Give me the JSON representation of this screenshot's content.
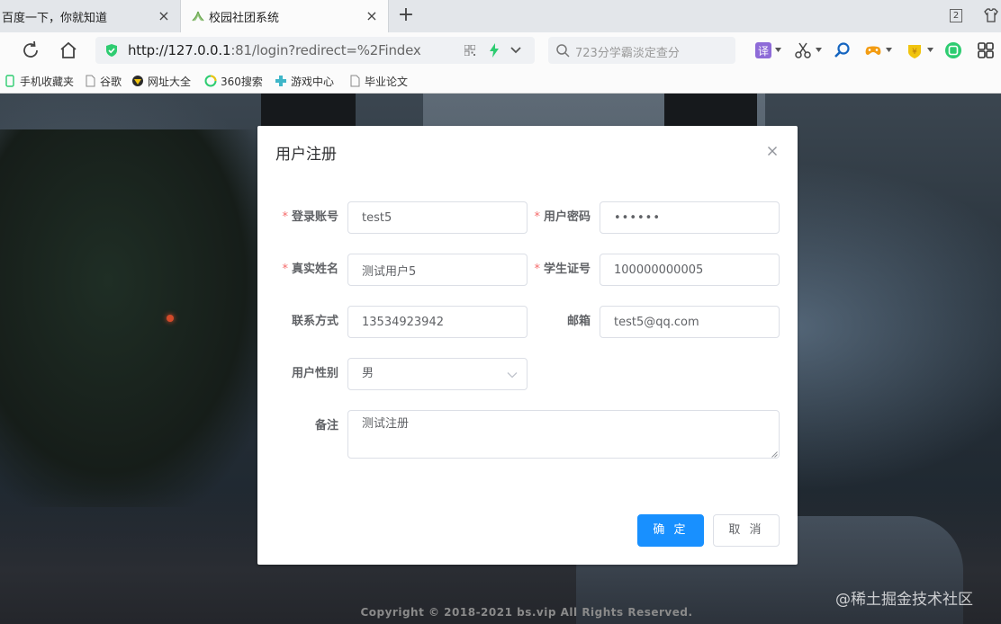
{
  "browser": {
    "tabs": [
      {
        "title": "百度一下，你就知道",
        "active": false
      },
      {
        "title": "校园社团系统",
        "active": true
      }
    ],
    "new_tab_symbol": "+",
    "tab_counter": "2",
    "url_host": "http://127.0.0.1",
    "url_rest": ":81/login?redirect=%2Findex",
    "search_placeholder": "723分学霸淡定查分",
    "bookmarks": [
      "手机收藏夹",
      "谷歌",
      "网址大全",
      "360搜索",
      "游戏中心",
      "毕业论文"
    ]
  },
  "dialog": {
    "title": "用户注册",
    "required_mark": "*",
    "fields": {
      "account": {
        "label": "登录账号",
        "value": "test5",
        "required": true
      },
      "password": {
        "label": "用户密码",
        "value": "••••••",
        "required": true
      },
      "real_name": {
        "label": "真实姓名",
        "value": "测试用户5",
        "required": true
      },
      "student_id": {
        "label": "学生证号",
        "value": "100000000005",
        "required": true
      },
      "phone": {
        "label": "联系方式",
        "value": "13534923942",
        "required": false
      },
      "email": {
        "label": "邮箱",
        "value": "test5@qq.com",
        "required": false
      },
      "gender": {
        "label": "用户性别",
        "value": "男",
        "required": false
      },
      "remark": {
        "label": "备注",
        "value": "测试注册",
        "required": false
      }
    },
    "confirm_label": "确 定",
    "cancel_label": "取 消"
  },
  "page": {
    "copyright": "Copyright © 2018-2021 bs.vip All Rights Reserved.",
    "watermark": "@稀土掘金技术社区"
  },
  "colors": {
    "primary": "#1890ff",
    "required": "#f56c6c",
    "label": "#606266",
    "border": "#dcdfe6"
  }
}
